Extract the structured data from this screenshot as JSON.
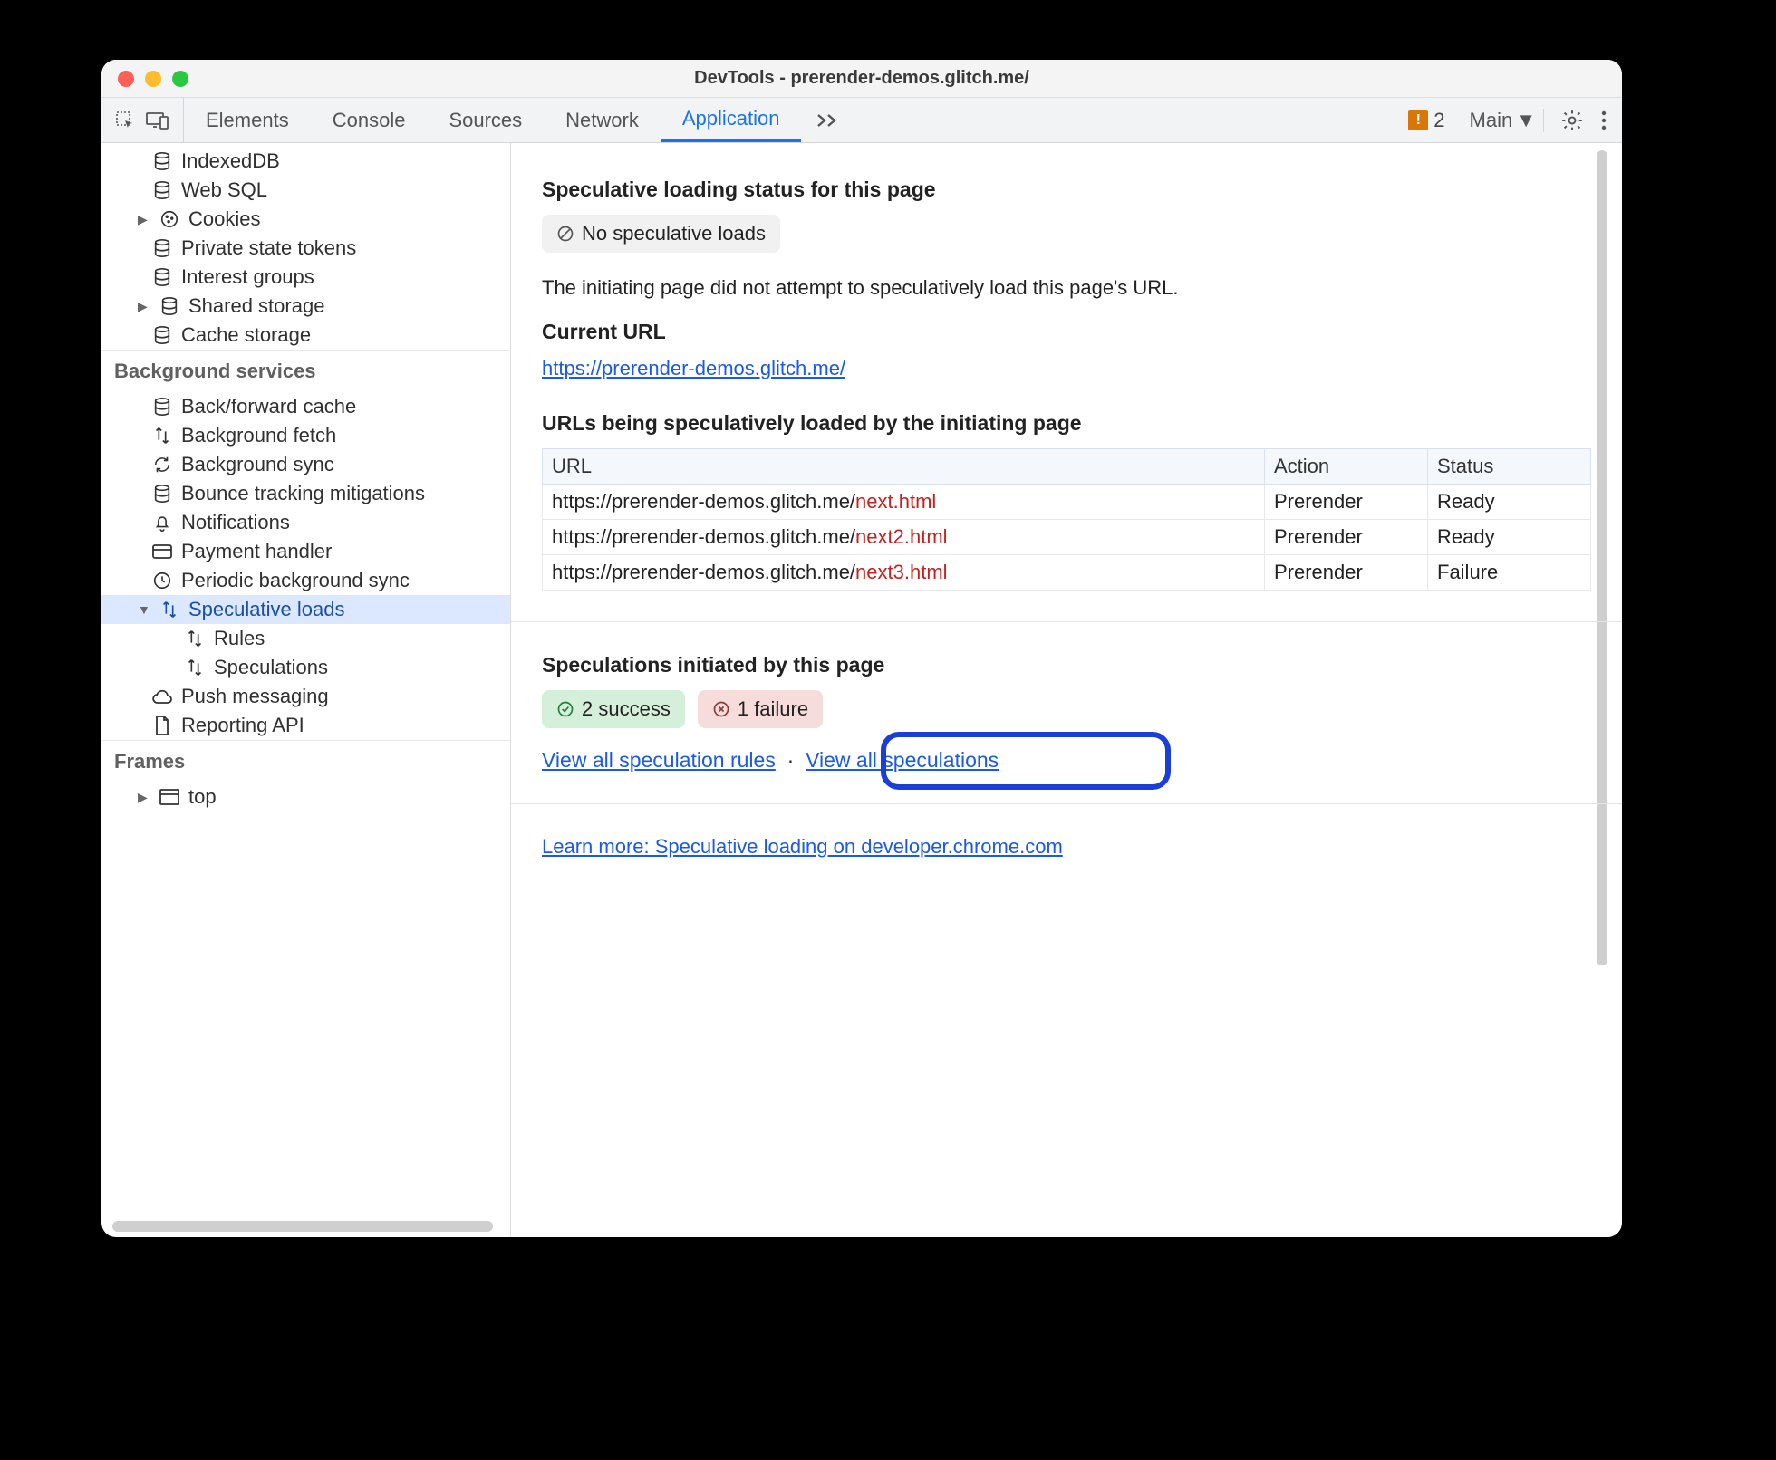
{
  "window_title": "DevTools - prerender-demos.glitch.me/",
  "tabs": [
    "Elements",
    "Console",
    "Sources",
    "Network",
    "Application"
  ],
  "active_tab": "Application",
  "warning_count": "2",
  "target_label": "Main",
  "sidebar": {
    "storage_items": [
      {
        "icon": "db",
        "label": "IndexedDB",
        "arrow": false
      },
      {
        "icon": "db",
        "label": "Web SQL",
        "arrow": false
      },
      {
        "icon": "cookie",
        "label": "Cookies",
        "arrow": true
      },
      {
        "icon": "db",
        "label": "Private state tokens",
        "arrow": false
      },
      {
        "icon": "db",
        "label": "Interest groups",
        "arrow": false
      },
      {
        "icon": "db",
        "label": "Shared storage",
        "arrow": true
      },
      {
        "icon": "db",
        "label": "Cache storage",
        "arrow": false
      }
    ],
    "bg_header": "Background services",
    "bg_items": [
      {
        "icon": "db",
        "label": "Back/forward cache"
      },
      {
        "icon": "arrows",
        "label": "Background fetch"
      },
      {
        "icon": "sync",
        "label": "Background sync"
      },
      {
        "icon": "db",
        "label": "Bounce tracking mitigations"
      },
      {
        "icon": "bell",
        "label": "Notifications"
      },
      {
        "icon": "card",
        "label": "Payment handler"
      },
      {
        "icon": "clock",
        "label": "Periodic background sync"
      }
    ],
    "spec_parent": "Speculative loads",
    "spec_children": [
      "Rules",
      "Speculations"
    ],
    "bg_tail": [
      {
        "icon": "cloud",
        "label": "Push messaging"
      },
      {
        "icon": "doc",
        "label": "Reporting API"
      }
    ],
    "frames_header": "Frames",
    "frames_item": "top"
  },
  "main": {
    "status_header": "Speculative loading status for this page",
    "status_pill": "No speculative loads",
    "status_desc": "The initiating page did not attempt to speculatively load this page's URL.",
    "current_url_header": "Current URL",
    "current_url": "https://prerender-demos.glitch.me/",
    "urls_header": "URLs being speculatively loaded by the initiating page",
    "table_headers": {
      "url": "URL",
      "action": "Action",
      "status": "Status"
    },
    "rows": [
      {
        "base": "https://prerender-demos.glitch.me/",
        "path": "next.html",
        "action": "Prerender",
        "status": "Ready"
      },
      {
        "base": "https://prerender-demos.glitch.me/",
        "path": "next2.html",
        "action": "Prerender",
        "status": "Ready"
      },
      {
        "base": "https://prerender-demos.glitch.me/",
        "path": "next3.html",
        "action": "Prerender",
        "status": "Failure"
      }
    ],
    "spec_header": "Speculations initiated by this page",
    "success_pill": "2 success",
    "failure_pill": "1 failure",
    "link_rules": "View all speculation rules",
    "link_specs": "View all speculations",
    "learn_more": "Learn more: Speculative loading on developer.chrome.com"
  }
}
